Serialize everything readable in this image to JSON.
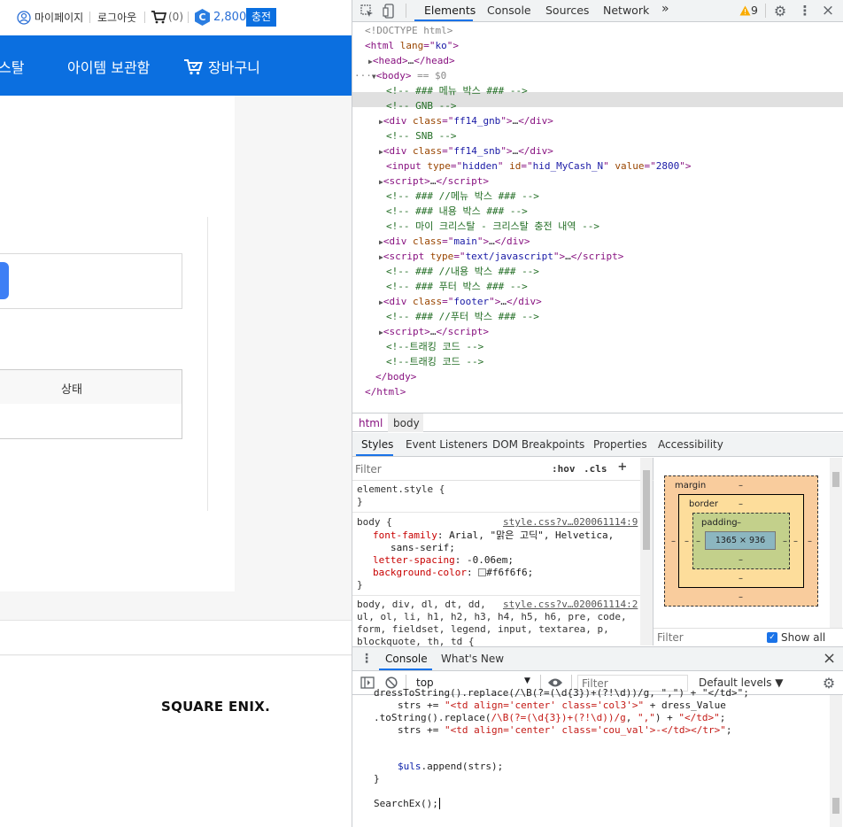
{
  "site": {
    "topbar": {
      "mypage": "마이페이지",
      "logout": "로그아웃",
      "cart_count": "(0)",
      "cash_badge": "C",
      "cash_amount": "2,800",
      "charge_button": "충전"
    },
    "gnb": {
      "item_partial": "스탈",
      "item_storage": "아이템 보관함",
      "item_cart": "장바구니"
    },
    "table": {
      "status_header": "상태"
    },
    "footer": {
      "logo_text": "SQUARE ENIX."
    }
  },
  "devtools": {
    "tabs": [
      "Elements",
      "Console",
      "Sources",
      "Network"
    ],
    "more_tabs": "»",
    "warning_count": "9",
    "dom": {
      "doctype": "<!DOCTYPE html>",
      "lines": [
        "<!-- ### 메뉴 박스 ### -->",
        "<!-- GNB -->",
        "<!-- SNB -->",
        "<!-- ### //메뉴 박스 ### -->",
        "<!-- ### 내용 박스 ### -->",
        "<!-- 마이 크리스탈 - 크리스탈 충전 내역 -->",
        "<!-- ### //내용 박스 ### -->",
        "<!-- ### 푸터 박스 ### -->",
        "<!-- ### //푸터 박스 ### -->",
        "<!--트래킹 코드 -->",
        "<!--트래킹 코드 -->"
      ],
      "html_lang": "ko",
      "gnb_class": "ff14_gnb",
      "snb_class": "ff14_snb",
      "hidden_id": "hid_MyCash_N",
      "hidden_value": "2800",
      "main_class": "main",
      "script_type": "text/javascript",
      "footer_class": "footer",
      "body_marker": "== $0"
    },
    "breadcrumbs": [
      "html",
      "body"
    ],
    "subtabs": [
      "Styles",
      "Event Listeners",
      "DOM Breakpoints",
      "Properties",
      "Accessibility"
    ],
    "styles": {
      "filter_placeholder": "Filter",
      "hov": ":hov",
      "cls": ".cls",
      "add": "+",
      "element_style": "element.style {",
      "close_brace": "}",
      "body_selector": "body {",
      "body_source": "style.css?v…020061114:9",
      "font_family_prop": "font-family",
      "font_family_val": "Arial, \"맑은 고딕\", Helvetica,",
      "font_family_val2": "sans-serif;",
      "letter_spacing_prop": "letter-spacing",
      "letter_spacing_val": "-0.06em;",
      "bg_prop": "background-color",
      "bg_val": "#f6f6f6;",
      "bg_swatch": "#f6f6f6",
      "reset_selector_1": "body, div, dl, dt, dd,",
      "reset_source": "style.css?v…020061114:2",
      "reset_selector_2": "ul, ol, li, h1, h2, h3, h4, h5, h6, pre, code,",
      "reset_selector_3": "form, fieldset, legend, input, textarea, p,",
      "reset_selector_4": "blockquote, th, td {"
    },
    "boxmodel": {
      "margin": "margin",
      "border": "border",
      "padding": "padding",
      "dash": "–",
      "content": "1365 × 936",
      "filter_placeholder": "Filter",
      "show_all": "Show all"
    },
    "drawer": {
      "tabs": [
        "Console",
        "What's New"
      ],
      "close": "×",
      "context": "top",
      "filter_placeholder": "Filter",
      "levels": "Default levels ▼"
    },
    "console": {
      "line0": "dressToString().replace(/\\B(?=(\\d{3})+(?!\\d))/g, \",\") + \"</td>\";",
      "line1a": "strs += ",
      "line1b": "\"<td align='center' class='col3'>\"",
      "line1c": " + dress_Value",
      "line2a": ".toString().replace(",
      "line2b": "/\\B(?=(\\d{3})+(?!\\d))/g",
      "line2c": ", ",
      "line2d": "\",\"",
      "line2e": ") + ",
      "line2f": "\"</td>\"",
      "line2g": ";",
      "line3a": "strs += ",
      "line3b": "\"<td align='center' class='cou_val'>-</td></tr>\"",
      "line3c": ";",
      "line4a": "$uls",
      "line4b": ".append(strs);",
      "line5": "}",
      "line6": "SearchEx();"
    }
  },
  "colors": {
    "gnb_blue": "#0b6fe0",
    "accent_blue": "#1a73e8",
    "warning": "#f9ab00"
  }
}
